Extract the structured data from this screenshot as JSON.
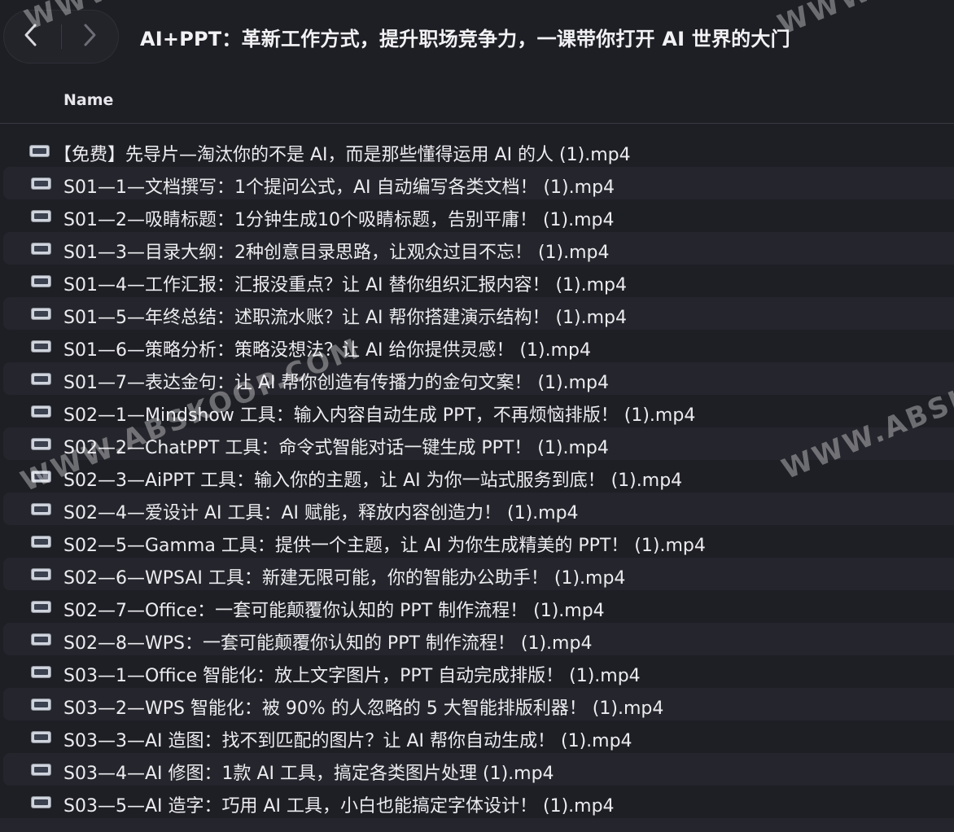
{
  "window": {
    "title": "AI+PPT：革新工作方式，提升职场竞争力，一课带你打开 AI 世界的大门"
  },
  "navigation": {
    "back_icon": "chevron-left-icon",
    "forward_icon": "chevron-right-icon"
  },
  "table": {
    "column_name": "Name",
    "files": [
      "【免费】先导片—淘汰你的不是 AI，而是那些懂得运用 AI 的人 (1).mp4",
      "S01—1—文档撰写：1个提问公式，AI 自动编写各类文档！ (1).mp4",
      "S01—2—吸睛标题：1分钟生成10个吸睛标题，告别平庸！ (1).mp4",
      "S01—3—目录大纲：2种创意目录思路，让观众过目不忘！ (1).mp4",
      "S01—4—工作汇报：汇报没重点？让 AI 替你组织汇报内容！ (1).mp4",
      "S01—5—年终总结：述职流水账？让 AI 帮你搭建演示结构！ (1).mp4",
      "S01—6—策略分析：策略没想法？让 AI 给你提供灵感！ (1).mp4",
      "S01—7—表达金句：让 AI 帮你创造有传播力的金句文案！ (1).mp4",
      "S02—1—Mindshow 工具：输入内容自动生成 PPT，不再烦恼排版！ (1).mp4",
      "S02—2—ChatPPT 工具：命令式智能对话一键生成 PPT！ (1).mp4",
      "S02—3—AiPPT 工具：输入你的主题，让 AI 为你一站式服务到底！ (1).mp4",
      "S02—4—爱设计 AI 工具：AI 赋能，释放内容创造力！ (1).mp4",
      "S02—5—Gamma 工具：提供一个主题，让 AI 为你生成精美的 PPT！ (1).mp4",
      "S02—6—WPSAI 工具：新建无限可能，你的智能办公助手！ (1).mp4",
      "S02—7—Office：一套可能颠覆你认知的 PPT 制作流程！ (1).mp4",
      "S02—8—WPS：一套可能颠覆你认知的 PPT 制作流程！ (1).mp4",
      "S03—1—Office 智能化：放上文字图片，PPT 自动完成排版！ (1).mp4",
      "S03—2—WPS 智能化：被 90% 的人忽略的 5 大智能排版利器！ (1).mp4",
      "S03—3—AI 造图：找不到匹配的图片？让 AI 帮你自动生成！ (1).mp4",
      "S03—4—AI 修图：1款 AI 工具，搞定各类图片处理 (1).mp4",
      "S03—5—AI 造字：巧用 AI 工具，小白也能搞定字体设计！ (1).mp4"
    ],
    "file_icon": "video-file-icon"
  },
  "watermarks": [
    "WWW.ABSKOOP.COM",
    "WWW.ABSK",
    "WWW.",
    "WWW."
  ]
}
